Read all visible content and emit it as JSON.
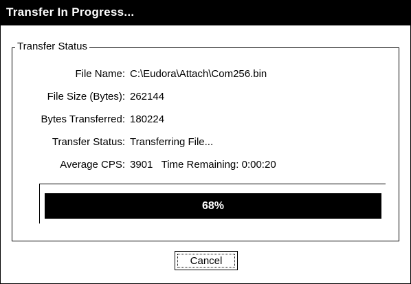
{
  "window": {
    "title": "Transfer In Progress..."
  },
  "group": {
    "legend": "Transfer Status"
  },
  "fields": {
    "file_name_label": "File Name:",
    "file_name_value": "C:\\Eudora\\Attach\\Com256.bin",
    "file_size_label": "File Size (Bytes):",
    "file_size_value": "262144",
    "bytes_transferred_label": "Bytes Transferred:",
    "bytes_transferred_value": "180224",
    "transfer_status_label": "Transfer Status:",
    "transfer_status_value": "Transferring File...",
    "average_cps_label": "Average CPS:",
    "average_cps_value": "3901",
    "time_remaining_label": "Time Remaining:",
    "time_remaining_value": "0:00:20"
  },
  "progress": {
    "label": "68%",
    "fraction": 1.0
  },
  "buttons": {
    "cancel_label": "Cancel"
  },
  "colors": {
    "titlebar": "#000000",
    "progress_fill": "#000000",
    "background": "#ffffff"
  }
}
